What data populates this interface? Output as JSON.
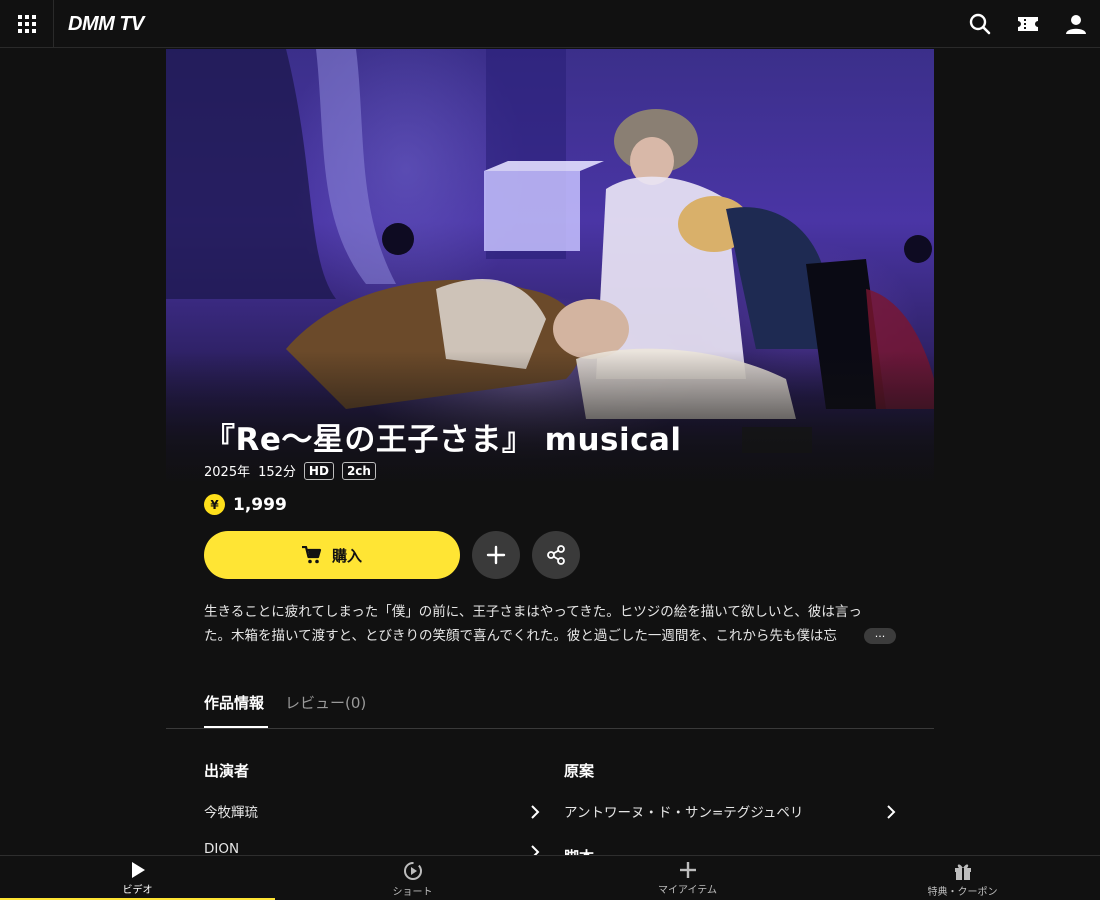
{
  "header": {
    "logo": "DMM TV",
    "icons": [
      "apps-grid-icon",
      "search-icon",
      "ticket-icon",
      "user-icon"
    ]
  },
  "work": {
    "title": "『Re〜星の王子さま』 musical",
    "year": "2025年",
    "duration": "152分",
    "badges": [
      "HD",
      "2ch"
    ],
    "price": "1,999",
    "currency_symbol": "¥",
    "buy_label": "購入",
    "more_label": "···",
    "description_line1": "生きることに疲れてしまった「僕」の前に、王子さまはやってきた。ヒツジの絵を描いて欲しいと、彼は言っ",
    "description_line2": "た。木箱を描いて渡すと、とびきりの笑顔で喜んでくれた。彼と過ごした一週間を、これから先も僕は忘"
  },
  "tabs": [
    {
      "label": "作品情報",
      "active": true
    },
    {
      "label": "レビュー(0)",
      "active": false
    }
  ],
  "info": {
    "cast_heading": "出演者",
    "cast": [
      "今牧輝琉",
      "DION"
    ],
    "original_heading": "原案",
    "original": [
      "アントワーヌ・ド・サン=テグジュペリ"
    ],
    "next_heading": "脚本"
  },
  "bottom_nav": [
    {
      "label": "ビデオ",
      "icon": "play-icon",
      "active": true
    },
    {
      "label": "ショート",
      "icon": "shorts-icon",
      "active": false
    },
    {
      "label": "マイアイテム",
      "icon": "plus-icon",
      "active": false
    },
    {
      "label": "特典・クーポン",
      "icon": "gift-icon",
      "active": false
    }
  ],
  "colors": {
    "accent": "#ffe534",
    "background": "#111111",
    "button_dark": "#3a3a3a"
  }
}
